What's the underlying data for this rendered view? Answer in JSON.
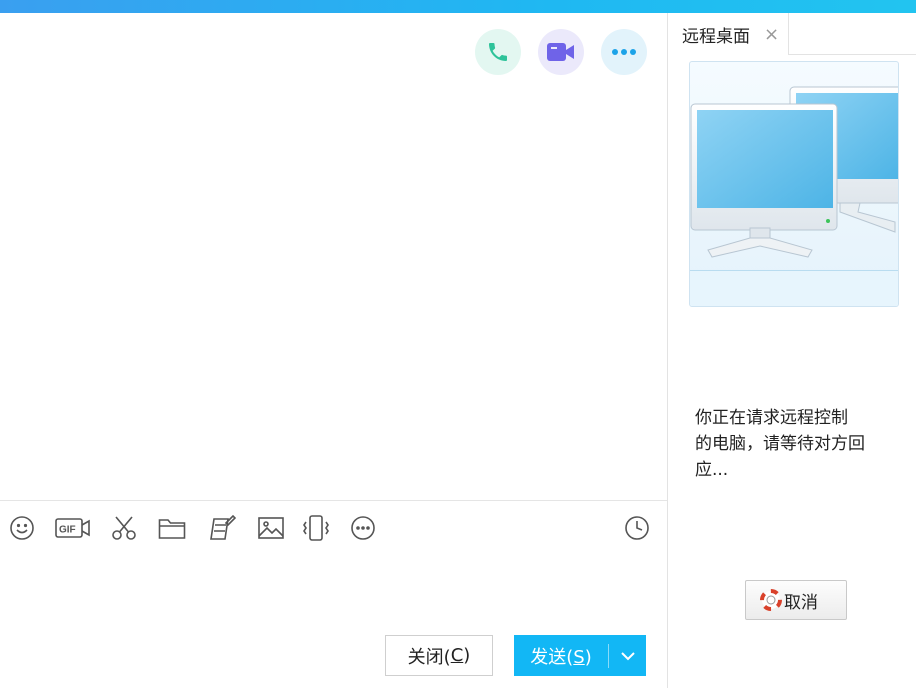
{
  "chat": {
    "toolbar_icons": [
      "emoji-icon",
      "gif-icon",
      "scissors-icon",
      "folder-icon",
      "screenshot-edit-icon",
      "image-icon",
      "shake-icon",
      "more-icon",
      "history-clock-icon"
    ],
    "close_label": "关闭(",
    "close_key": "C",
    "close_end": ")",
    "send_label": "发送(",
    "send_key": "S",
    "send_end": ")"
  },
  "side": {
    "tab_label": "远程桌面",
    "tab_close": "×",
    "message_line1": "你正在请求远程控制",
    "message_line2": "的电脑，请等待对方回",
    "message_line3": "应...",
    "cancel_label": "取消"
  },
  "colors": {
    "accent": "#12b7f5",
    "phone": "#2ec39a",
    "video": "#6f63e8",
    "more": "#1ca3e8"
  }
}
